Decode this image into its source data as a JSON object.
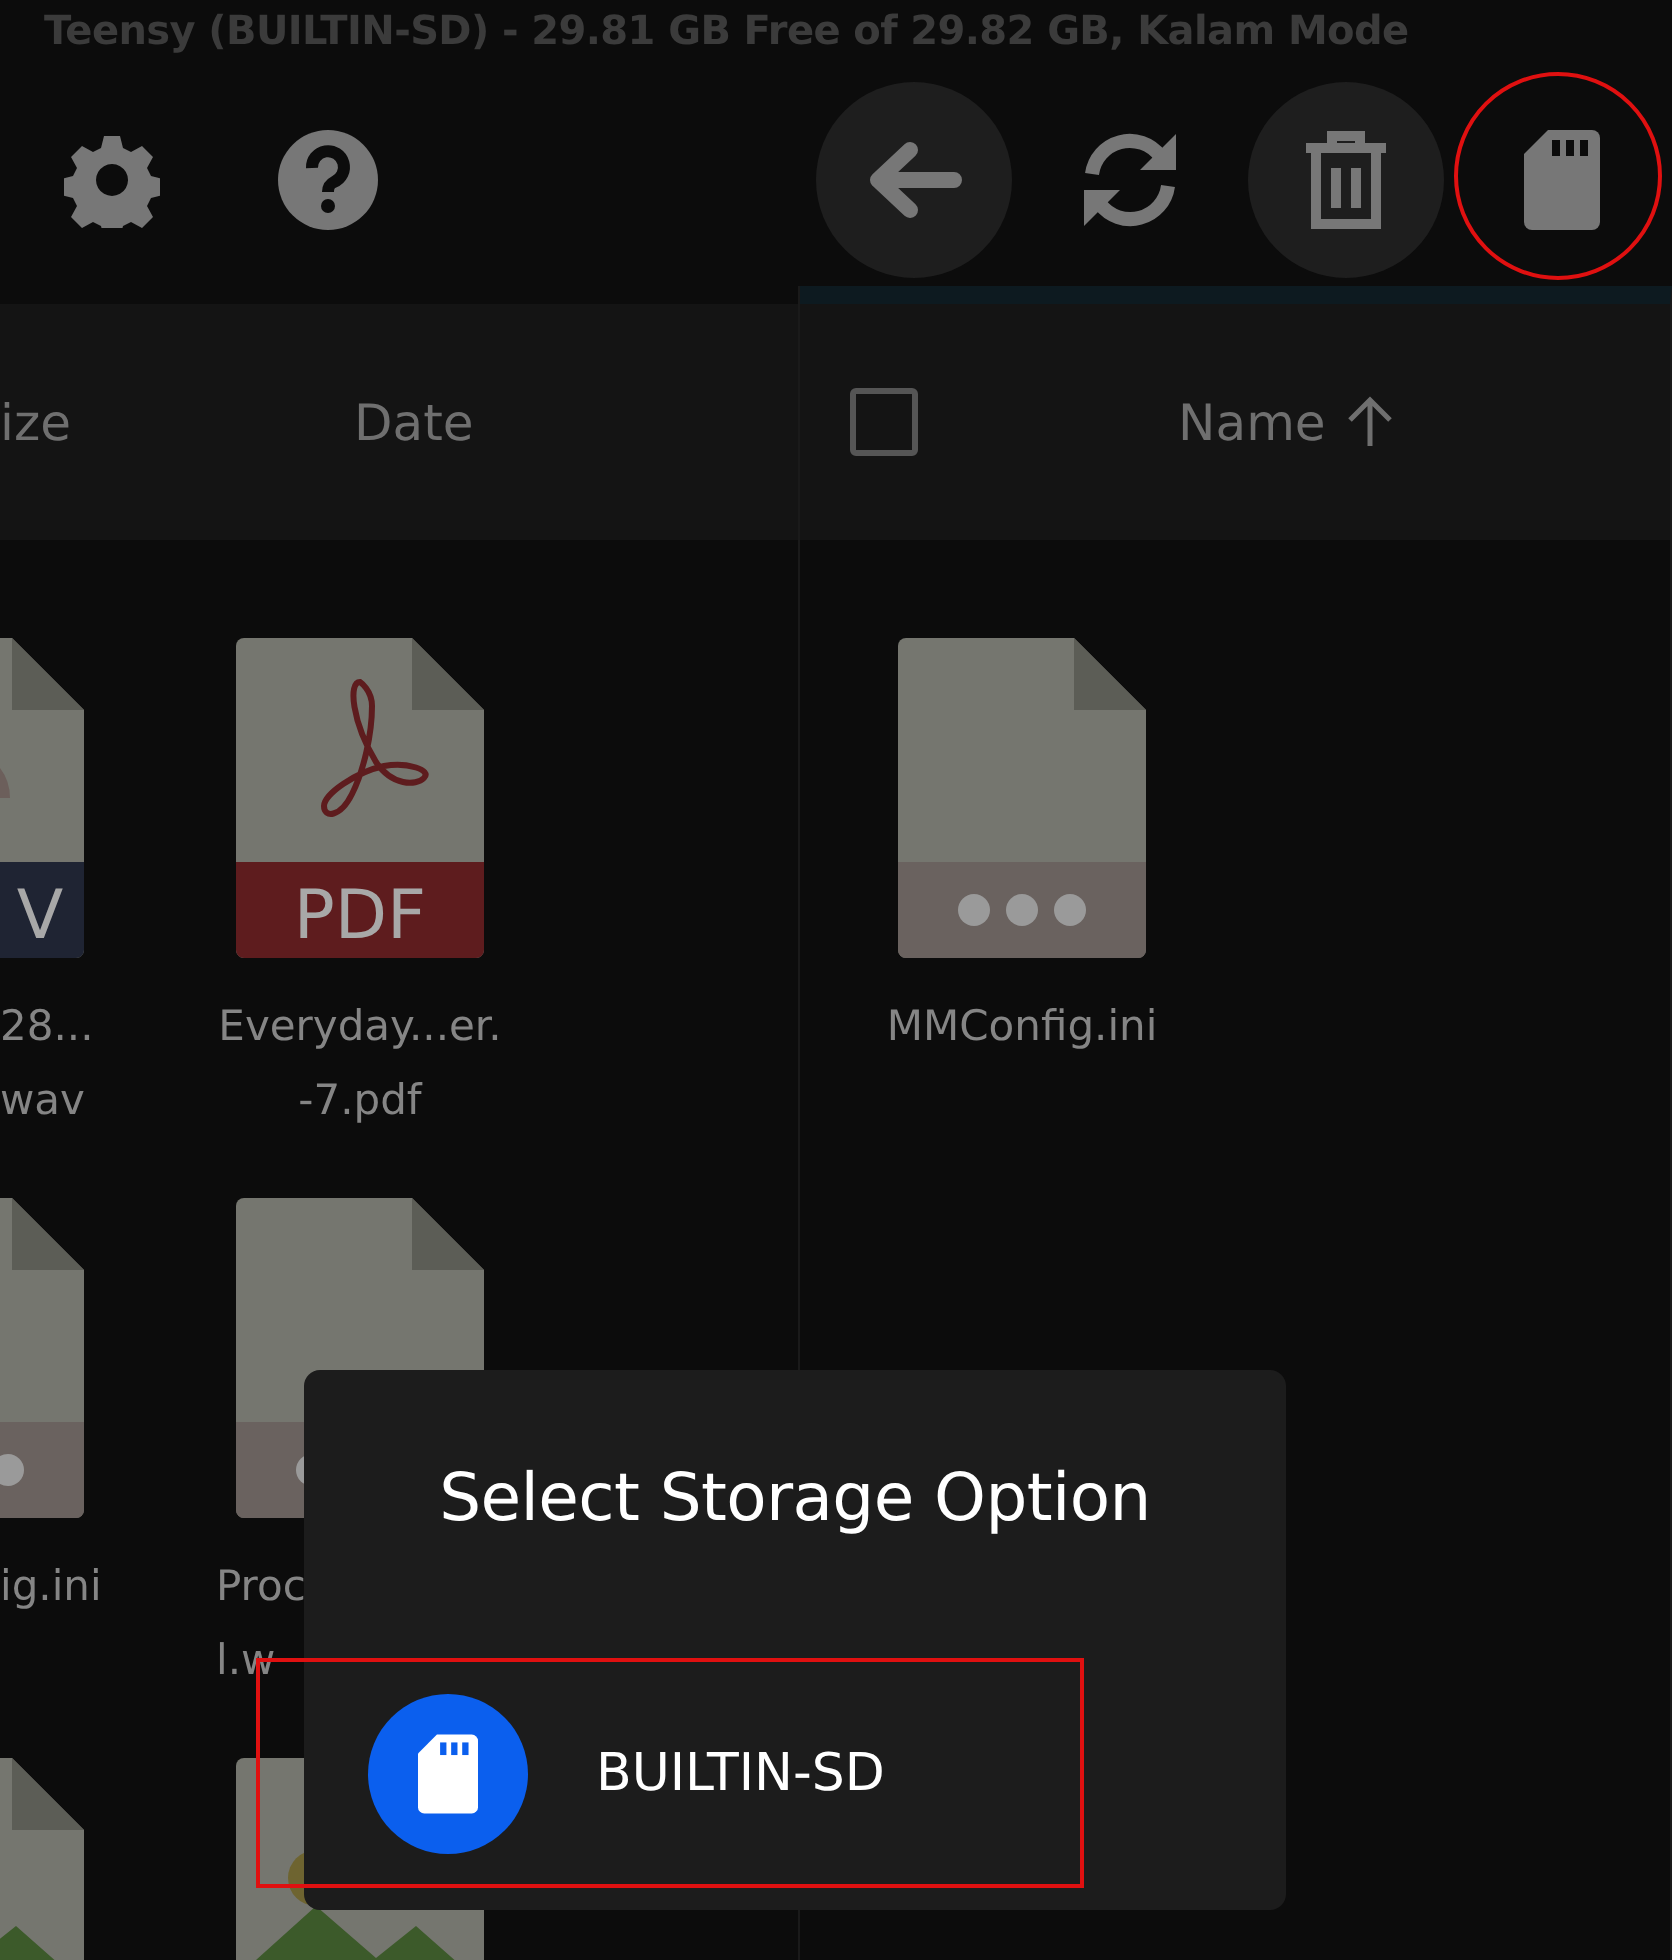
{
  "title": "Teensy (BUILTIN-SD) - 29.81 GB Free of 29.82 GB, Kalam Mode",
  "toolbar": {
    "left": [
      {
        "kind": "settings"
      },
      {
        "kind": "help"
      }
    ],
    "right": [
      {
        "kind": "back",
        "filled": true,
        "highlighted": false
      },
      {
        "kind": "refresh",
        "filled": false,
        "highlighted": false
      },
      {
        "kind": "trash",
        "filled": true,
        "highlighted": false
      },
      {
        "kind": "sdcard",
        "filled": false,
        "highlighted": true
      }
    ]
  },
  "left_pane": {
    "columns": [
      "ize",
      "Date"
    ],
    "tiles": [
      {
        "kind": "audio",
        "badge": "V",
        "label": [
          "28...",
          "wav"
        ],
        "partly_hidden": false
      },
      {
        "kind": "pdf",
        "badge": "PDF",
        "label": [
          "Everyday...er.",
          "-7.pdf"
        ],
        "partly_hidden": false
      },
      {
        "kind": "ini",
        "label": [
          "ig.ini"
        ],
        "partly_hidden": false
      },
      {
        "kind": "ini",
        "label": [
          "Proc",
          "l.w"
        ],
        "partly_hidden": true
      },
      {
        "kind": "image"
      },
      {
        "kind": "image"
      }
    ]
  },
  "right_pane": {
    "select_all_checked": false,
    "columns": [
      {
        "label": "Name",
        "sorted": true
      }
    ],
    "tiles": [
      {
        "kind": "ini",
        "label": [
          "MMConfig.ini"
        ],
        "partly_hidden": false
      }
    ]
  },
  "dialog": {
    "title": "Select Storage Option",
    "options": [
      {
        "label": "BUILTIN-SD",
        "highlighted": true
      }
    ]
  }
}
